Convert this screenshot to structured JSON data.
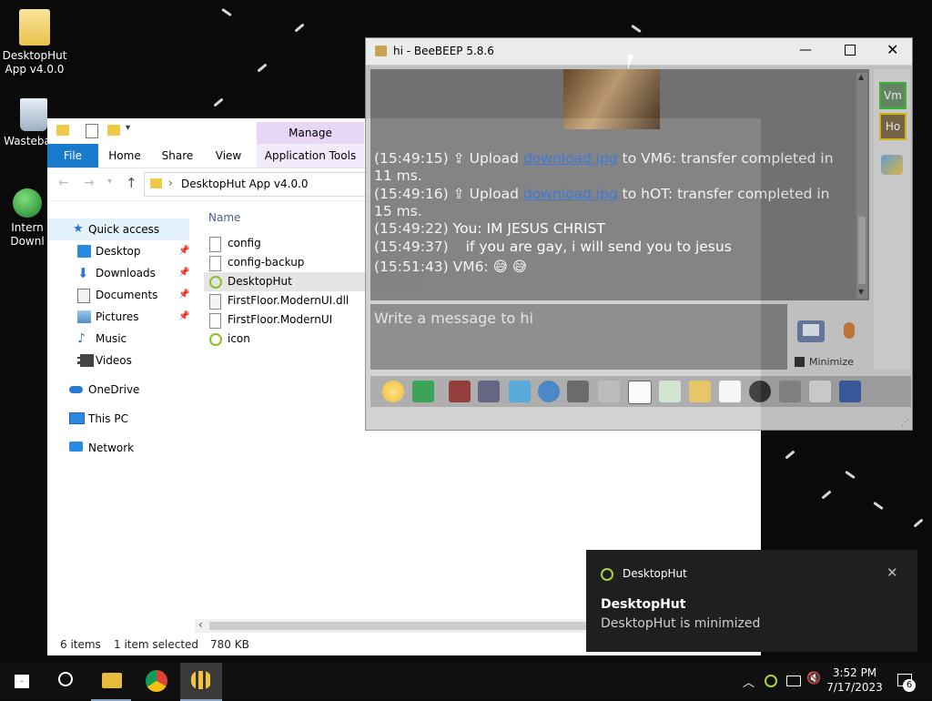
{
  "desktop": {
    "icons": [
      {
        "label_line1": "DesktopHut",
        "label_line2": "App v4.0.0"
      },
      {
        "label_line1": "Wasteba",
        "label_line2": ""
      },
      {
        "label_line1": "Intern",
        "label_line2": "Downl"
      }
    ]
  },
  "explorer": {
    "ribbon": {
      "contextual_tab": "Manage",
      "tabs": [
        "File",
        "Home",
        "Share",
        "View",
        "Application Tools"
      ]
    },
    "address": {
      "path": "DesktopHut App v4.0.0"
    },
    "nav": {
      "quick_access": "Quick access",
      "items": [
        "Desktop",
        "Downloads",
        "Documents",
        "Pictures",
        "Music",
        "Videos"
      ],
      "onedrive": "OneDrive",
      "this_pc": "This PC",
      "network": "Network"
    },
    "column_header": "Name",
    "files": [
      {
        "name": "config",
        "icon": "text-file-icon"
      },
      {
        "name": "config-backup",
        "icon": "text-file-icon"
      },
      {
        "name": "DesktopHut",
        "icon": "app-icon",
        "selected": true
      },
      {
        "name": "FirstFloor.ModernUI.dll",
        "icon": "dll-file-icon"
      },
      {
        "name": "FirstFloor.ModernUI",
        "icon": "xml-file-icon"
      },
      {
        "name": "icon",
        "icon": "app-icon"
      }
    ],
    "status": {
      "items": "6 items",
      "selected": "1 item selected",
      "size": "780 KB"
    }
  },
  "beebeep": {
    "title": "hi - BeeBEEP 5.8.6",
    "messages": [
      {
        "time": "(15:49:15)",
        "pre": "Upload ",
        "link": "download.jpg",
        "post": " to VM6: transfer completed in",
        "wrap": "11 ms."
      },
      {
        "time": "(15:49:16)",
        "pre": "Upload ",
        "link": "download.jpg",
        "post": " to hOT: transfer completed in",
        "wrap": "15 ms."
      },
      {
        "time": "(15:49:22)",
        "sender": "You:",
        "text": " IM JESUS CHRIST"
      },
      {
        "time": "(15:49:37)",
        "text": "if you are gay, i will send you to jesus"
      },
      {
        "time": "(15:51:43)",
        "sender": "VM6:",
        "text": "😅 😅"
      }
    ],
    "input_placeholder": "Write a message to hi",
    "minimize_label": "Minimize",
    "users": [
      "Vm",
      "Ho"
    ]
  },
  "toast": {
    "app": "DesktopHut",
    "title": "DesktopHut",
    "body": "DesktopHut is minimized"
  },
  "taskbar": {
    "time": "3:52 PM",
    "date": "7/17/2023",
    "notification_count": "6"
  },
  "colors": {
    "accent": "#1979ca",
    "manage_tab": "#e8d6f7",
    "selected_row": "#e5e5e5",
    "link": "#2f6fd6"
  }
}
